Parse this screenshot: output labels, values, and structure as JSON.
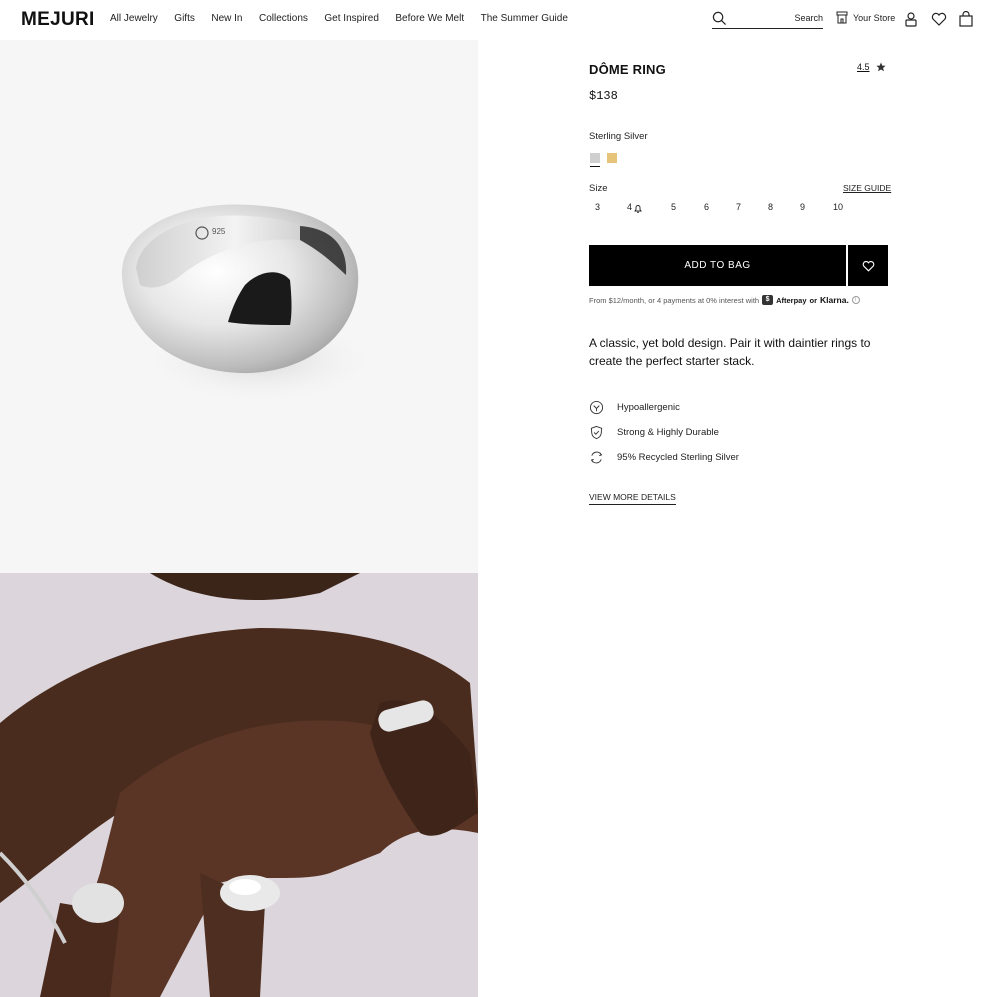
{
  "brand": {
    "logo": "MEJURI"
  },
  "nav": {
    "items": [
      "All Jewelry",
      "Gifts",
      "New In",
      "Collections",
      "Get Inspired",
      "Before We Melt",
      "The Summer Guide"
    ]
  },
  "search": {
    "label": "Search"
  },
  "header_actions": {
    "store_label": "Your Store"
  },
  "product": {
    "name": "DÔME RING",
    "rating": "4.5",
    "price": "$138",
    "metal_label": "Sterling Silver",
    "swatches": [
      {
        "name": "Sterling Silver",
        "color": "#cfcfcf",
        "selected": true
      },
      {
        "name": "Gold",
        "color": "#e6c47a",
        "selected": false
      }
    ],
    "size_label": "Size",
    "size_guide_label": "SIZE GUIDE",
    "sizes": [
      "3",
      "4",
      "5",
      "6",
      "7",
      "8",
      "9",
      "10"
    ],
    "add_to_bag_label": "ADD TO BAG",
    "payments": {
      "text": "From $12/month, or 4 payments at 0% interest with",
      "afterpay": "Afterpay",
      "or": "or",
      "klarna": "Klarna."
    },
    "description": "A classic, yet bold design. Pair it with daintier rings to create the perfect starter stack.",
    "features": [
      {
        "icon": "hypoallergenic-icon",
        "label": "Hypoallergenic"
      },
      {
        "icon": "shield-check-icon",
        "label": "Strong & Highly Durable"
      },
      {
        "icon": "recycle-icon",
        "label": "95% Recycled Sterling Silver"
      }
    ],
    "view_more_label": "VIEW MORE DETAILS"
  },
  "images": {
    "top_engraving": "925"
  }
}
